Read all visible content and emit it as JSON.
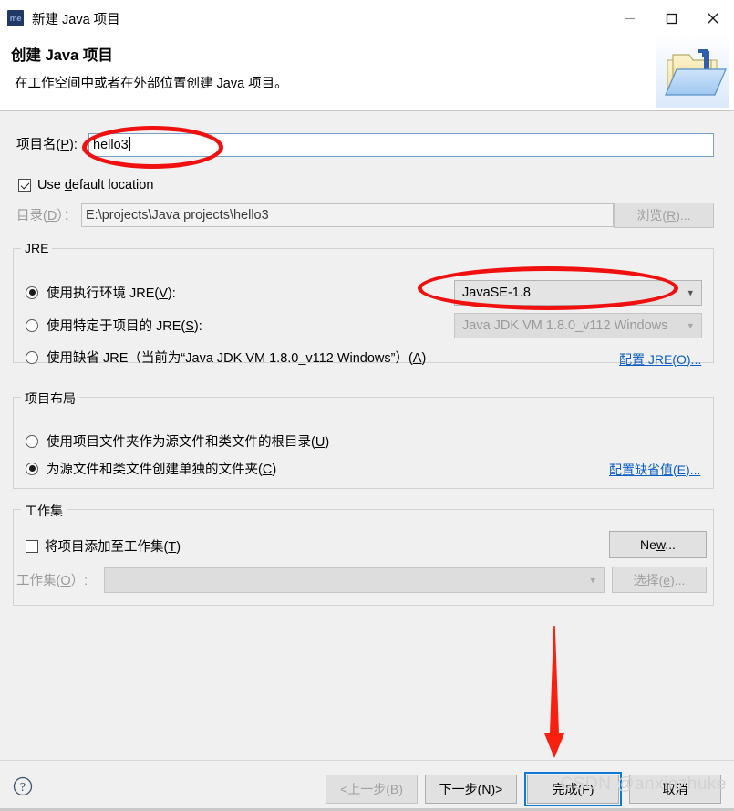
{
  "window": {
    "title": "新建 Java 项目",
    "app_icon_text": "me",
    "controls": {
      "minimize": "minimize-icon",
      "maximize": "maximize-icon",
      "close": "close-icon"
    }
  },
  "header": {
    "title": "创建 Java 项目",
    "subtitle": "在工作空间中或者在外部位置创建 Java 项目。",
    "banner_icon": "java-project-folder-icon"
  },
  "project_name": {
    "label_prefix": "项目名(",
    "label_mnemonic": "P",
    "label_suffix": "):",
    "value": "hello3"
  },
  "default_location": {
    "checkbox_checked": true,
    "label_before": "Use ",
    "label_mnemonic": "d",
    "label_after": "efault location"
  },
  "directory": {
    "label_prefix": "目录(",
    "label_mnemonic": "D",
    "label_suffix": "）：",
    "value": "E:\\projects\\Java projects\\hello3",
    "browse_button_prefix": "浏览(",
    "browse_button_mnemonic": "R",
    "browse_button_suffix": ")...",
    "browse_disabled": true
  },
  "jre": {
    "group_title": "JRE",
    "options": [
      {
        "label_prefix": "使用执行环境 JRE(",
        "label_mnemonic": "V",
        "label_suffix": "):",
        "selected": true,
        "combo_value": "JavaSE-1.8",
        "combo_disabled": false
      },
      {
        "label_prefix": "使用特定于项目的 JRE(",
        "label_mnemonic": "S",
        "label_suffix": "):",
        "selected": false,
        "combo_value": "Java JDK VM 1.8.0_v112 Windows",
        "combo_disabled": true
      },
      {
        "label_prefix": "使用缺省 JRE（当前为“Java JDK VM 1.8.0_v112 Windows”）(",
        "label_mnemonic": "A",
        "label_suffix": ")",
        "selected": false
      }
    ],
    "config_link_prefix": "配置 JRE(",
    "config_link_mnemonic": "O",
    "config_link_suffix": ")..."
  },
  "project_layout": {
    "group_title": "项目布局",
    "options": [
      {
        "label_prefix": "使用项目文件夹作为源文件和类文件的根目录(",
        "label_mnemonic": "U",
        "label_suffix": ")",
        "selected": false
      },
      {
        "label_prefix": "为源文件和类文件创建单独的文件夹(",
        "label_mnemonic": "C",
        "label_suffix": ")",
        "selected": true
      }
    ],
    "config_link_prefix": "配置缺省值(",
    "config_link_mnemonic": "E",
    "config_link_suffix": ")..."
  },
  "working_set": {
    "group_title": "工作集",
    "checkbox_checked": false,
    "checkbox_label_prefix": "将项目添加至工作集(",
    "checkbox_label_mnemonic": "T",
    "checkbox_label_suffix": ")",
    "new_button_prefix": "Ne",
    "new_button_mnemonic": "w",
    "new_button_suffix": "...",
    "combo_label_prefix": "工作集(",
    "combo_label_mnemonic": "O",
    "combo_label_suffix": "）:",
    "combo_value": "",
    "combo_disabled": true,
    "select_button_prefix": "选择(",
    "select_button_mnemonic": "e",
    "select_button_suffix": ")...",
    "select_disabled": true
  },
  "footer": {
    "help_icon": "help-icon",
    "buttons": [
      {
        "prefix": "<上一步(",
        "mnemonic": "B",
        "suffix": ")",
        "disabled": true,
        "focused": false
      },
      {
        "prefix": "下一步(",
        "mnemonic": "N",
        "suffix": ")>",
        "disabled": false,
        "focused": false
      },
      {
        "prefix": "完成(",
        "mnemonic": "F",
        "suffix": ")",
        "disabled": false,
        "focused": true
      },
      {
        "prefix": "取消",
        "mnemonic": "",
        "suffix": "",
        "disabled": false,
        "focused": false
      }
    ]
  },
  "watermark": "CSDN @anxinzhuke",
  "annotations": {
    "ellipse_color": "#f01010",
    "arrow_color": "#fa2010",
    "ellipse_project_name": "highlight-project-name",
    "ellipse_jre_combo": "highlight-jre-combo",
    "arrow_finish": "pointer-to-finish-button"
  },
  "colors": {
    "accent": "#0f7ad6",
    "link": "#0b5fc4",
    "annotation": "#f01010",
    "background": "#f0f0f0",
    "titlebar": "#ffffff"
  }
}
